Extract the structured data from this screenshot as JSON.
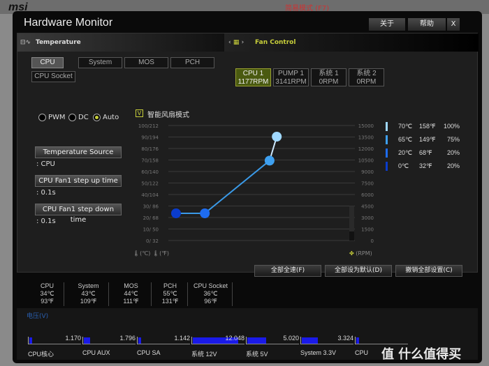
{
  "background": {
    "mode_label": "简易模式 (F7)"
  },
  "window": {
    "title": "Hardware Monitor",
    "buttons": [
      "关于",
      "帮助",
      "X"
    ]
  },
  "temperature": {
    "header": "Temperature",
    "tabs": [
      "CPU",
      "System",
      "MOS",
      "PCH",
      "CPU Socket"
    ],
    "selected": "CPU"
  },
  "fan_control": {
    "header": "Fan Control",
    "fans": [
      {
        "name": "CPU 1",
        "rpm": "1177RPM"
      },
      {
        "name": "PUMP 1",
        "rpm": "3141RPM"
      },
      {
        "name": "系统 1",
        "rpm": "0RPM"
      },
      {
        "name": "系统 2",
        "rpm": "0RPM"
      }
    ],
    "selected": "CPU 1"
  },
  "mode": {
    "options": [
      "PWM",
      "DC",
      "Auto"
    ],
    "selected": "Auto"
  },
  "settings": [
    {
      "label": "Temperature Source",
      "value": ": CPU"
    },
    {
      "label": "CPU Fan1 step up time",
      "value": ": 0.1s"
    },
    {
      "label": "CPU Fan1 step down time",
      "value": ": 0.1s"
    }
  ],
  "smart_fan": {
    "label": "智能风扇模式",
    "checked": true,
    "check_mark": "V"
  },
  "chart_data": {
    "type": "line",
    "left_ticks": [
      "100/212",
      "90/194",
      "80/176",
      "70/158",
      "60/140",
      "50/122",
      "40/104",
      "30/ 86",
      "20/ 68",
      "10/ 50",
      "0/ 32"
    ],
    "right_ticks": [
      "15000",
      "13500",
      "12000",
      "10500",
      "9000",
      "7500",
      "6000",
      "4500",
      "3000",
      "1500",
      "0"
    ],
    "xlabel_c": "(℃)",
    "xlabel_f": "(℉)",
    "rpm_label": "(RPM)",
    "points": [
      {
        "temp_c": 0,
        "percent": 20,
        "color": "#0a3ccc"
      },
      {
        "temp_c": 20,
        "percent": 20,
        "color": "#1e6cf0"
      },
      {
        "temp_c": 65,
        "percent": 75,
        "color": "#3ea0f0"
      },
      {
        "temp_c": 70,
        "percent": 100,
        "color": "#9fd8ff"
      }
    ],
    "line_color": "#3a9ae8",
    "current_rpm_level": 1177
  },
  "legend": [
    {
      "c": "70℃",
      "f": "158℉",
      "p": "100%",
      "color": "#9fd8ff"
    },
    {
      "c": "65℃",
      "f": "149℉",
      "p": "75%",
      "color": "#3ea0f0"
    },
    {
      "c": "20℃",
      "f": "68℉",
      "p": "20%",
      "color": "#1e6cf0"
    },
    {
      "c": "0℃",
      "f": "32℉",
      "p": "20%",
      "color": "#0a3ccc"
    }
  ],
  "actions": [
    "全部全速(F)",
    "全部设为默认(D)",
    "撤销全部设置(C)"
  ],
  "temps": [
    {
      "name": "CPU",
      "c": "34℃",
      "f": "93℉"
    },
    {
      "name": "System",
      "c": "43℃",
      "f": "109℉"
    },
    {
      "name": "MOS",
      "c": "44℃",
      "f": "111℉"
    },
    {
      "name": "PCH",
      "c": "55℃",
      "f": "131℉"
    },
    {
      "name": "CPU Socket",
      "c": "36℃",
      "f": "96℉"
    }
  ],
  "voltage": {
    "label": "电压(V)",
    "items": [
      {
        "name": "CPU核心",
        "value": "1.170",
        "fill": 0.05
      },
      {
        "name": "CPU AUX",
        "value": "1.796",
        "fill": 0.12
      },
      {
        "name": "CPU SA",
        "value": "1.142",
        "fill": 0.05
      },
      {
        "name": "系统 12V",
        "value": "12.048",
        "fill": 0.85
      },
      {
        "name": "系统 5V",
        "value": "5.020",
        "fill": 0.35
      },
      {
        "name": "System 3.3V",
        "value": "3.324",
        "fill": 0.3
      },
      {
        "name": "CPU",
        "value": "",
        "fill": 0.05
      }
    ]
  },
  "watermark": "值 什么值得买"
}
